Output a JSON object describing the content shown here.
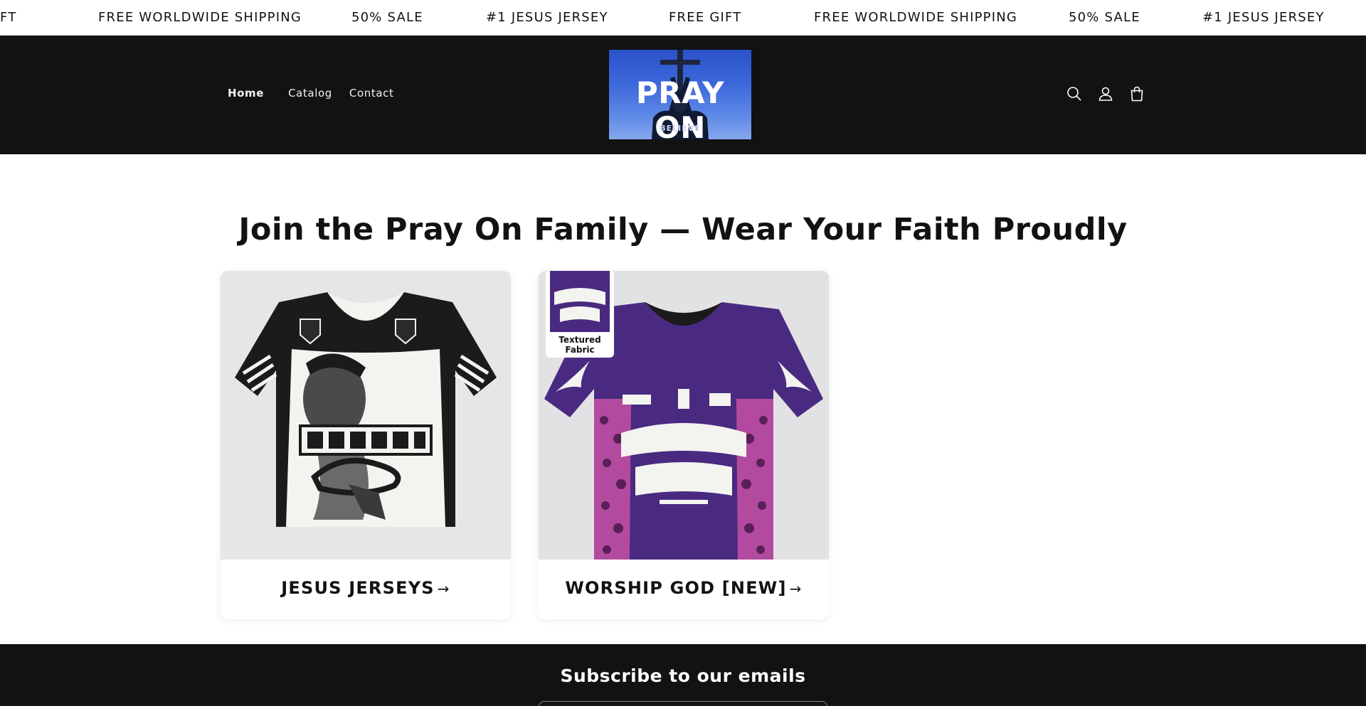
{
  "announcement": {
    "items": [
      "FT",
      "FREE WORLDWIDE SHIPPING",
      "50% SALE",
      "#1 JESUS JERSEY",
      "FREE GIFT",
      "FREE WORLDWIDE SHIPPING",
      "50% SALE",
      "#1 JESUS JERSEY"
    ]
  },
  "header": {
    "nav": [
      {
        "label": "Home"
      },
      {
        "label": "Catalog"
      },
      {
        "label": "Contact"
      }
    ],
    "logo": {
      "text": "PRAY ON",
      "small": "BELIEVE"
    },
    "icons": [
      "search-icon",
      "account-icon",
      "cart-icon"
    ],
    "background": "#121212"
  },
  "main": {
    "headline": "Join the Pray On Family — Wear Your Faith Proudly",
    "collections": [
      {
        "title": "JESUS JERSEYS",
        "arrow": "→",
        "jersey_color": "#1b1b1b"
      },
      {
        "title": "WORSHIP GOD [NEW]",
        "arrow": "→",
        "jersey_color": "#4a2a80",
        "badge": "Textured Fabric"
      }
    ]
  },
  "footer": {
    "subscribe_title": "Subscribe to our emails",
    "background": "#121212"
  }
}
